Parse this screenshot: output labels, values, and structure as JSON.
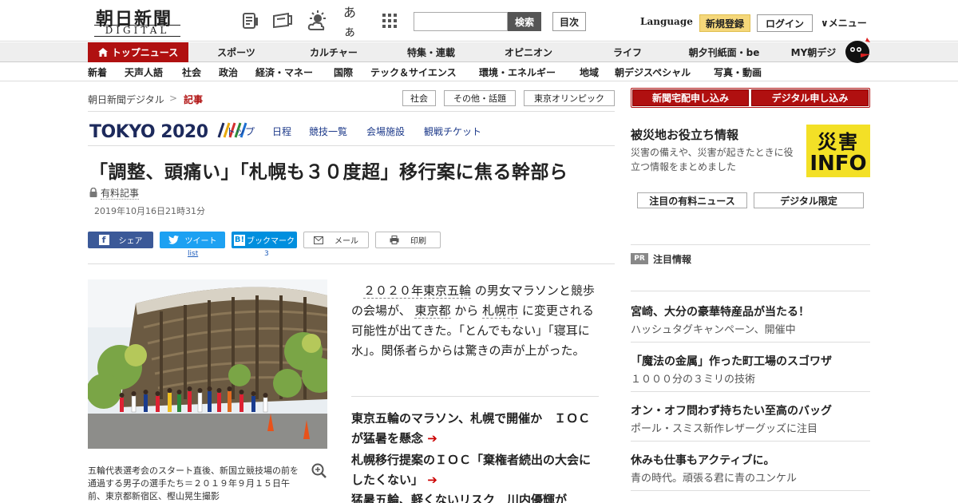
{
  "header": {
    "logo": "朝日新聞",
    "logo_sub": "DIGITAL",
    "moji_label": "あぁ",
    "search_button": "検索",
    "mokuji_button": "目次",
    "language": "Language",
    "register": "新規登録",
    "login": "ログイン",
    "menu": "メニュー"
  },
  "main_nav": [
    "トップニュース",
    "スポーツ",
    "カルチャー",
    "特集・連載",
    "オピニオン",
    "ライフ",
    "朝夕刊紙面・be",
    "MY朝デジ"
  ],
  "sub_nav": [
    "新着",
    "天声人語",
    "社会",
    "政治",
    "経済・マネー",
    "国際",
    "テック＆サイエンス",
    "環境・エネルギー",
    "地域",
    "朝デジスペシャル",
    "写真・動画"
  ],
  "breadcrumb": {
    "home": "朝日新聞デジタル",
    "sep": ">",
    "current": "記事"
  },
  "tags": [
    "社会",
    "その他・話題",
    "東京オリンピック"
  ],
  "tokyo": {
    "logo": "TOKYO 2020",
    "nav": [
      "トップ",
      "日程",
      "競技一覧",
      "会場施設",
      "観戦チケット"
    ]
  },
  "article": {
    "title": "「調整、頭痛い」「札幌も３０度超」移行案に焦る幹部ら",
    "paid_label": "有料記事",
    "date": "2019年10月16日21時31分",
    "share": {
      "facebook": "シェア",
      "twitter": "ツイート",
      "twitter_count": "list",
      "hatena": "ブックマーク",
      "hatena_count": "3",
      "mail": "メール",
      "print": "印刷"
    },
    "lead": {
      "p1_indent": "　",
      "link1": "２０２０年東京五輪",
      "t1": "の男女マラソンと競歩の会場が、",
      "link2": "東京都",
      "t2": "から",
      "link3": "札幌市",
      "t3": "に変更される可能性が出てきた。「とんでもない」「寝耳に水」。関係者らからは驚きの声が上がった。"
    },
    "related": [
      "東京五輪のマラソン、札幌で開催か　ＩＯＣが猛暑を懸念",
      "札幌移行提案のＩＯＣ「棄権者続出の大会にしたくない」",
      "猛暑五輪、軽くないリスク　川内優輝が"
    ],
    "caption": "五輪代表選考会のスタート直後、新国立競技場の前を通過する男子の選手たち＝２０１９年９月１５日午前、東京都新宿区、樫山晃生撮影"
  },
  "sidebar": {
    "buttons": [
      "新聞宅配申し込み",
      "デジタル申し込み"
    ],
    "disaster_title": "被災地お役立ち情報",
    "disaster_text": "災害の備えや、災害が起きたときに役立つ情報をまとめました",
    "info_top": "災害",
    "info_bottom": "INFO",
    "tabs": [
      "注目の有料ニュース",
      "デジタル限定"
    ],
    "pr_badge": "PR",
    "pr_label": "注目情報",
    "ads": [
      {
        "title": "宮崎、大分の豪華特産品が当たる！",
        "sub": "ハッシュタグキャンペーン、開催中"
      },
      {
        "title": "「魔法の金属」作った町工場のスゴワザ",
        "sub": "１０００分の３ミリの技術"
      },
      {
        "title": "オン・オフ問わず持ちたい至高のバッグ",
        "sub": "ポール・スミス新作レザーグッズに注目"
      },
      {
        "title": "休みも仕事もアクティブに。",
        "sub": "青の時代。頑張る君に青のユンケル"
      }
    ]
  },
  "colors": {
    "accent_red": "#b01010",
    "tokyo_navy": "#1d2a5c",
    "info_yellow": "#f3e026",
    "register_yellow": "#f5d77a"
  }
}
